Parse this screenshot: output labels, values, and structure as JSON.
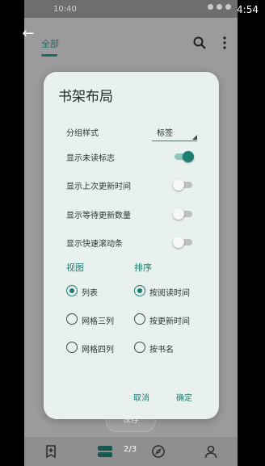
{
  "system": {
    "time": "4:54"
  },
  "app": {
    "status_time": "10:40",
    "tab_all": "全部",
    "page_count": "2/3",
    "save_label": "保存"
  },
  "dialog": {
    "title": "书架布局",
    "group_style_label": "分组样式",
    "group_style_value": "标签",
    "toggles": [
      {
        "label": "显示未读标志",
        "on": true
      },
      {
        "label": "显示上次更新时间",
        "on": false
      },
      {
        "label": "显示等待更新数量",
        "on": false
      },
      {
        "label": "显示快速滚动条",
        "on": false
      }
    ],
    "view_header": "视图",
    "sort_header": "排序",
    "view_options": [
      {
        "label": "列表",
        "selected": true
      },
      {
        "label": "网格三列",
        "selected": false
      },
      {
        "label": "网格四列",
        "selected": false
      }
    ],
    "sort_options": [
      {
        "label": "按阅读时间",
        "selected": true
      },
      {
        "label": "按更新时间",
        "selected": false
      },
      {
        "label": "按书名",
        "selected": false
      }
    ],
    "cancel_label": "取消",
    "confirm_label": "确定"
  },
  "colors": {
    "accent": "#1f7d70",
    "dialog_bg": "#e9f1ef",
    "scrim": "#9b9b9b"
  }
}
